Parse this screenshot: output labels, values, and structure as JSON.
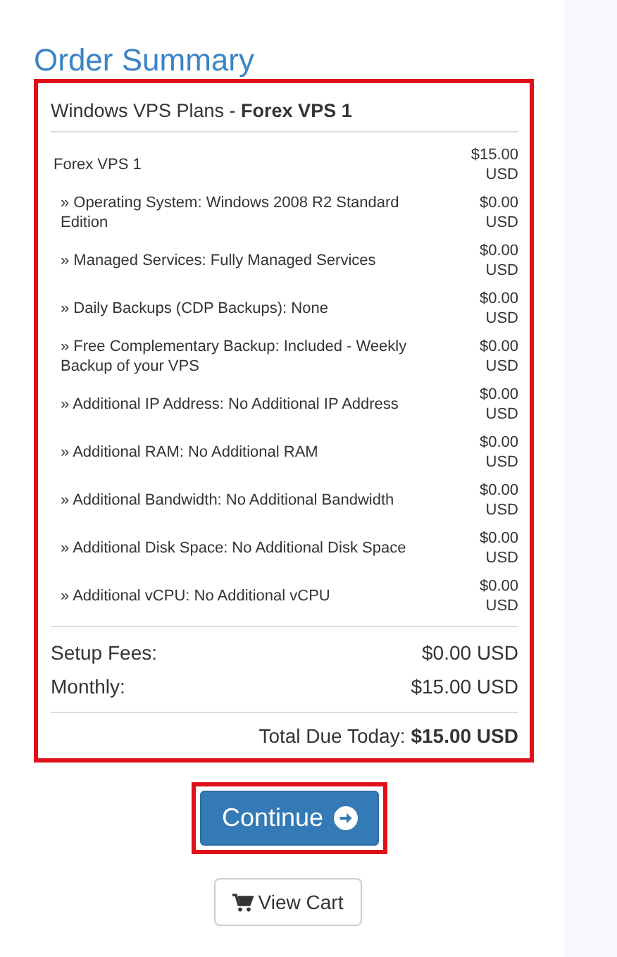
{
  "title": "Order Summary",
  "summary": {
    "highlighted": true,
    "heading": "Windows VPS Plans - **Forex VPS 1**",
    "items": [
      {
        "kind": "main",
        "label": "Forex VPS 1",
        "price": "$15.00 USD"
      },
      {
        "kind": "option",
        "label": "» Operating System: Windows 2008 R2 Standard Edition",
        "price": "$0.00 USD"
      },
      {
        "kind": "option",
        "label": "» Managed Services: Fully Managed Services",
        "price": "$0.00 USD"
      },
      {
        "kind": "option",
        "label": "» Daily Backups (CDP Backups): None",
        "price": "$0.00 USD"
      },
      {
        "kind": "option",
        "label": "» Free Complementary Backup: Included - Weekly Backup of your VPS",
        "price": "$0.00 USD"
      },
      {
        "kind": "option",
        "label": "» Additional IP Address: No Additional IP Address",
        "price": "$0.00 USD"
      },
      {
        "kind": "option",
        "label": "» Additional RAM: No Additional RAM",
        "price": "$0.00 USD"
      },
      {
        "kind": "option",
        "label": "» Additional Bandwidth: No Additional Bandwidth",
        "price": "$0.00 USD"
      },
      {
        "kind": "option",
        "label": "» Additional Disk Space: No Additional Disk Space",
        "price": "$0.00 USD"
      },
      {
        "kind": "option",
        "label": "» Additional vCPU: No Additional vCPU",
        "price": "$0.00 USD"
      }
    ],
    "totals": [
      {
        "label": "Setup Fees:",
        "value": "$0.00 USD"
      },
      {
        "label": "Monthly:",
        "value": "$15.00 USD"
      }
    ],
    "total_due": {
      "label": "Total Due Today:",
      "value": "$15.00 USD"
    }
  },
  "continue_button": {
    "label": "Continue",
    "highlighted": true
  },
  "view_cart_button": {
    "label": "View Cart"
  }
}
